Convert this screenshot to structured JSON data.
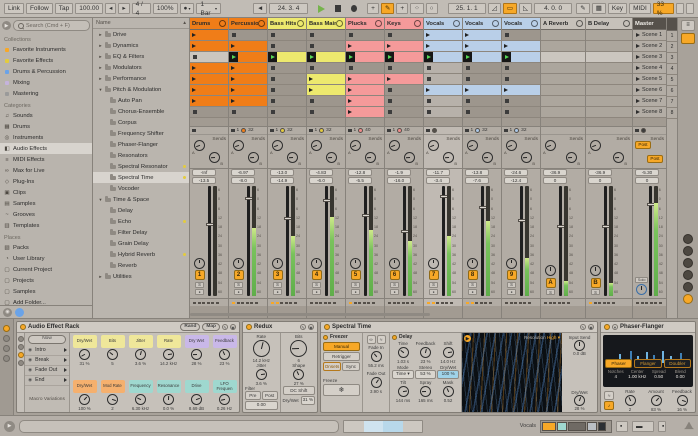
{
  "transport": {
    "link": "Link",
    "follow": "Follow",
    "tap": "Tap",
    "tempo": "100.00",
    "sig": "4 / 4",
    "quant": "100%",
    "launch_q": "1 Bar",
    "pos": "24. 3. 4",
    "loop_start": "25. 1. 1",
    "loop_len": "4. 0. 0",
    "key": "Key",
    "midi": "MIDI",
    "cpu": "33 %"
  },
  "sidebar": {
    "search": "Search (Cmd + F)",
    "sections": [
      {
        "title": "Collections",
        "items": [
          {
            "label": "Favorite Instruments",
            "color": "#f7a827"
          },
          {
            "label": "Favorite Effects",
            "color": "#e3cb3e"
          },
          {
            "label": "Drums & Percussion",
            "color": "#6aa3e8"
          },
          {
            "label": "Mixing",
            "color": "#c5b3dc"
          },
          {
            "label": "Mastering",
            "color": "#9a9a9a"
          }
        ]
      },
      {
        "title": "Categories",
        "items": [
          {
            "label": "Sounds",
            "icon": "♫"
          },
          {
            "label": "Drums",
            "icon": "▦"
          },
          {
            "label": "Instruments",
            "icon": "◎"
          },
          {
            "label": "Audio Effects",
            "icon": "◧",
            "selected": true
          },
          {
            "label": "MIDI Effects",
            "icon": "≡"
          },
          {
            "label": "Max for Live",
            "icon": "∞"
          },
          {
            "label": "Plug-Ins",
            "icon": "◇"
          },
          {
            "label": "Clips",
            "icon": "▣"
          },
          {
            "label": "Samples",
            "icon": "▤"
          },
          {
            "label": "Grooves",
            "icon": "~"
          },
          {
            "label": "Templates",
            "icon": "▥"
          }
        ]
      },
      {
        "title": "Places",
        "items": [
          {
            "label": "Packs",
            "icon": "▧"
          },
          {
            "label": "User Library",
            "icon": "◔"
          },
          {
            "label": "Current Project",
            "icon": "▢"
          },
          {
            "label": "Projects",
            "icon": "▢"
          },
          {
            "label": "Samples",
            "icon": "▢"
          },
          {
            "label": "Add Folder...",
            "icon": "▢",
            "underline": true
          }
        ]
      }
    ]
  },
  "browser": {
    "header": "Name",
    "items": [
      {
        "label": "Drive",
        "depth": 1,
        "arrow": "►"
      },
      {
        "label": "Dynamics",
        "depth": 1,
        "arrow": "►"
      },
      {
        "label": "EQ & Filters",
        "depth": 1,
        "arrow": "►"
      },
      {
        "label": "Modulators",
        "depth": 1,
        "arrow": "►"
      },
      {
        "label": "Performance",
        "depth": 1,
        "arrow": "►"
      },
      {
        "label": "Pitch & Modulation",
        "depth": 1,
        "arrow": "▼"
      },
      {
        "label": "Auto Pan",
        "depth": 2
      },
      {
        "label": "Chorus-Ensemble",
        "depth": 2
      },
      {
        "label": "Corpus",
        "depth": 2
      },
      {
        "label": "Frequency Shifter",
        "depth": 2
      },
      {
        "label": "Phaser-Flanger",
        "depth": 2
      },
      {
        "label": "Resonators",
        "depth": 2
      },
      {
        "label": "Spectral Resonator",
        "depth": 2,
        "dot": true
      },
      {
        "label": "Spectral Time",
        "depth": 2,
        "dot": true,
        "selected": true
      },
      {
        "label": "Vocoder",
        "depth": 2
      },
      {
        "label": "Time & Space",
        "depth": 1,
        "arrow": "▼"
      },
      {
        "label": "Delay",
        "depth": 2
      },
      {
        "label": "Echo",
        "depth": 2,
        "dot": true
      },
      {
        "label": "Filter Delay",
        "depth": 2
      },
      {
        "label": "Grain Delay",
        "depth": 2
      },
      {
        "label": "Hybrid Reverb",
        "depth": 2,
        "dot": true
      },
      {
        "label": "Reverb",
        "depth": 2
      },
      {
        "label": "Utilities",
        "depth": 1,
        "arrow": "►"
      }
    ]
  },
  "session": {
    "sends_label": "Sends",
    "post_label": "Post",
    "solo_label": "Solo",
    "db_scale": [
      "6",
      "0",
      "6",
      "12",
      "18",
      "24",
      "30",
      "36",
      "42",
      "48",
      "54",
      "60"
    ],
    "scenes": [
      {
        "name": "Scene 1",
        "num": "1"
      },
      {
        "name": "Scene 2",
        "num": "2"
      },
      {
        "name": "Scene 3",
        "num": "3"
      },
      {
        "name": "Scene 4",
        "num": "4"
      },
      {
        "name": "Scene 5",
        "num": "5"
      },
      {
        "name": "Scene 6",
        "num": "6"
      },
      {
        "name": "Scene 7",
        "num": "7"
      },
      {
        "name": "Scene 8",
        "num": "8"
      }
    ],
    "tracks": [
      {
        "name": "Drums",
        "kind": "audio",
        "color": "#f07d18",
        "clips": [
          "c",
          "c",
          "h",
          "c",
          "c",
          "c",
          "c",
          "s"
        ],
        "status": {
          "stop": true
        },
        "peak": "-Inf",
        "vol": "-13.5",
        "num": "1",
        "meter": 0,
        "fader": 34,
        "xfade": 0
      },
      {
        "name": "Percussion",
        "kind": "audio",
        "color": "#f07d18",
        "clips": [
          "s",
          "c",
          "p",
          "c",
          "c",
          "c",
          "c",
          "s"
        ],
        "status": {
          "stop": true,
          "num": "1",
          "len": "32",
          "pie": "#f07d18"
        },
        "peak": "-6.97",
        "vol": "-8.0",
        "num": "2",
        "meter": 62,
        "fader": 10,
        "xfade": 1
      },
      {
        "name": "Bass Hits",
        "kind": "audio",
        "color": "#ede96e",
        "clips": [
          "s",
          "s",
          "p",
          "s",
          "s",
          "s",
          "s",
          "s"
        ],
        "status": {
          "stop": true,
          "num": "1",
          "len": "32",
          "pie": "#e3cb3e"
        },
        "peak": "-13.0",
        "vol": "-14.9",
        "num": "3",
        "meter": 55,
        "fader": 28,
        "xfade": 2
      },
      {
        "name": "Bass Main",
        "kind": "audio",
        "color": "#ede96e",
        "clips": [
          "s",
          "s",
          "p",
          "s",
          "c",
          "c",
          "s",
          "s"
        ],
        "status": {
          "stop": true,
          "num": "1",
          "len": "32",
          "pie": "#e3cb3e"
        },
        "peak": "-4.83",
        "vol": "-6.0",
        "num": "4",
        "meter": 72,
        "fader": 12,
        "xfade": 0
      },
      {
        "name": "Plucks",
        "kind": "audio",
        "color": "#f59a9a",
        "clips": [
          "s",
          "c",
          "p",
          "s",
          "c",
          "c",
          "c",
          "c"
        ],
        "status": {
          "stop": true,
          "num": "1",
          "len": "40",
          "pie": "#f08a8a"
        },
        "peak": "-12.8",
        "vol": "-5.5",
        "num": "5",
        "meter": 60,
        "fader": 25,
        "xfade": 1
      },
      {
        "name": "Keys",
        "kind": "audio",
        "color": "#f59a9a",
        "clips": [
          "s",
          "c",
          "p",
          "s",
          "c",
          "s",
          "s",
          "s"
        ],
        "status": {
          "stop": true,
          "num": "1",
          "len": "40",
          "pie": "#f08a8a"
        },
        "peak": "-1.9",
        "vol": "-16.0",
        "num": "6",
        "meter": 50,
        "fader": 40,
        "xfade": 0
      },
      {
        "name": "Vocals",
        "kind": "audio",
        "color": "#b9cfe8",
        "selected": true,
        "clips": [
          "c",
          "c",
          "p",
          "s",
          "s",
          "c",
          "s",
          "s"
        ],
        "status": {
          "stop": true,
          "pie": "#55504a"
        },
        "peak": "-11.7",
        "vol": "-3.4",
        "num": "7",
        "meter": 55,
        "fader": 8,
        "xfade": 2
      },
      {
        "name": "Vocals",
        "kind": "audio",
        "color": "#b9cfe8",
        "clips": [
          "c",
          "c",
          "p",
          "s",
          "s",
          "c",
          "s",
          "s"
        ],
        "status": {
          "stop": true,
          "num": "1",
          "len": "32",
          "pie": "#a9c7e8"
        },
        "peak": "-13.8",
        "vol": "-7.6",
        "num": "8",
        "meter": 68,
        "fader": 18,
        "xfade": 2
      },
      {
        "name": "Vocals",
        "kind": "audio",
        "color": "#b9cfe8",
        "clips": [
          "s",
          "c",
          "p",
          "s",
          "s",
          "c",
          "s",
          "s"
        ],
        "status": {
          "stop": true,
          "num": "1",
          "len": "32",
          "pie": "#a9c7e8"
        },
        "peak": "-24.6",
        "vol": "-12.4",
        "num": "9",
        "meter": 35,
        "fader": 30,
        "xfade": 0
      },
      {
        "name": "A Reverb",
        "kind": "return",
        "color": "#c6c1ba",
        "clips": [
          "e",
          "e",
          "E",
          "e",
          "e",
          "e",
          "e",
          "e"
        ],
        "status": {},
        "peak": "-36.9",
        "vol": "0",
        "num": "A",
        "meter": 14,
        "fader": 35,
        "xfade": 0
      },
      {
        "name": "B Delay",
        "kind": "return",
        "color": "#c6c1ba",
        "clips": [
          "e",
          "e",
          "E",
          "e",
          "e",
          "e",
          "e",
          "e"
        ],
        "status": {},
        "peak": "-36.9",
        "vol": "0",
        "num": "B",
        "meter": 12,
        "fader": 35,
        "xfade": 1
      },
      {
        "name": "Master",
        "kind": "master",
        "color": "#56514b",
        "clips": [],
        "status": {
          "stop": true,
          "pie": "#3c3c3c"
        },
        "peak": "-5.30",
        "vol": "0",
        "num": "",
        "meter": 85,
        "fader": 15,
        "xfade": 0
      }
    ]
  },
  "devices": {
    "rack": {
      "title": "Audio Effect Rack",
      "now": "Now",
      "rand": "Rand",
      "map": "Map",
      "macro_variations": "Macro Variations",
      "chains": [
        "Intro",
        "Break",
        "Fade Out",
        "End"
      ],
      "macros": [
        {
          "label": "Dry/Wet",
          "value": "31 %",
          "color": "#efe79a",
          "row": 1
        },
        {
          "label": "Bits",
          "value": "5",
          "color": "#efe79a",
          "row": 1
        },
        {
          "label": "Jitter",
          "value": "3.6 %",
          "color": "#efe79a",
          "row": 1
        },
        {
          "label": "Rate",
          "value": "14.2 kHz",
          "color": "#efe79a",
          "row": 1
        },
        {
          "label": "Dry Wet",
          "value": "28 %",
          "color": "#c9b8e8",
          "row": 1
        },
        {
          "label": "Feedback",
          "value": "23 %",
          "color": "#c9b8e8",
          "row": 1
        },
        {
          "label": "Dry/Wet",
          "value": "100 %",
          "color": "#f5b06e",
          "row": 2
        },
        {
          "label": "Mod Rate",
          "value": "2",
          "color": "#f5b06e",
          "row": 2
        },
        {
          "label": "Frequency",
          "value": "6.30 kHz",
          "color": "#9fd8cf",
          "row": 2
        },
        {
          "label": "Resonance",
          "value": "0.0 %",
          "color": "#9fd8cf",
          "row": 2
        },
        {
          "label": "Drive",
          "value": "8.69 dB",
          "color": "#9fd8cf",
          "row": 2
        },
        {
          "label": "LFO Frequen",
          "value": "0.26 Hz",
          "color": "#9fd8cf",
          "row": 2
        }
      ]
    },
    "redux": {
      "title": "Redux",
      "left_knobs": [
        {
          "label": "Rate",
          "value": "14.2 kHz",
          "big": true
        },
        {
          "label": "Jitter",
          "value": "3.6 %"
        }
      ],
      "right_knobs": [
        {
          "label": "Bits",
          "value": "6",
          "big": true
        },
        {
          "label": "Shape",
          "value": "27 %"
        }
      ],
      "filter_label": "Filter",
      "pre": "Pre",
      "post": "Post",
      "filter_freq": "0.00",
      "dc_shift": "DC Shift",
      "dry_wet_label": "Dry/Wet",
      "dry_wet": "31 %"
    },
    "spectral": {
      "title": "Spectral Time",
      "freezer": {
        "label": "Freezer",
        "manual": "Manual",
        "retrigger": "Retrigger",
        "onsets": "Onsets",
        "sync": "Sync",
        "freeze": "Freeze"
      },
      "fade_in": {
        "label": "Fade In",
        "value": "55.2 ms"
      },
      "fade_out": {
        "label": "Fade Out",
        "value": "3.90 s"
      },
      "delay": {
        "label": "Delay",
        "knobs1": [
          {
            "label": "Time",
            "value": "1.03 s"
          },
          {
            "label": "Feedback",
            "value": "23 %"
          },
          {
            "label": "Shift",
            "value": "14.0 Hz"
          }
        ],
        "mode_label": "Mode",
        "mode": "Time",
        "stereo": "53 %",
        "dry_wet": "100 %",
        "knobs2": [
          {
            "label": "Tilt",
            "value": "144 ms"
          },
          {
            "label": "Spray",
            "value": "165 ms"
          },
          {
            "label": "Mask",
            "value": "0.52"
          }
        ]
      },
      "resolution_label": "Resolution",
      "resolution": "High",
      "input_send": {
        "label": "Input Send",
        "value": "0.0 dB"
      },
      "out_dry_wet": {
        "label": "Dry/Wet",
        "value": "28 %"
      }
    },
    "phaser": {
      "title": "Phaser-Flanger",
      "modes": [
        "Phaser",
        "Flanger",
        "Doubler"
      ],
      "params": [
        {
          "label": "Notches",
          "value": "4"
        },
        {
          "label": "Center",
          "value": "1.00 kHz"
        },
        {
          "label": "Spread",
          "value": "0.50"
        },
        {
          "label": "Blend",
          "value": "0.00"
        }
      ],
      "knobs": [
        {
          "label": "Rate",
          "value": "2"
        },
        {
          "label": "Amount",
          "value": "83 %"
        },
        {
          "label": "Feedback",
          "value": "16 %"
        }
      ]
    }
  },
  "status_bar": {
    "track": "Vocals"
  }
}
